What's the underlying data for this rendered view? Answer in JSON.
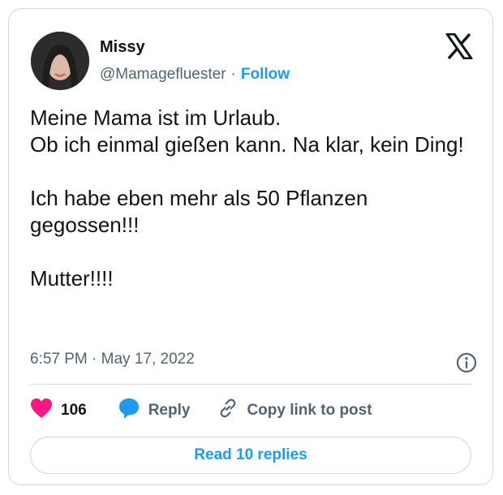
{
  "author": {
    "name": "Missy",
    "handle": "@Mamagefluester",
    "separator": "·",
    "follow_label": "Follow"
  },
  "tweet": {
    "lines": [
      "Meine Mama ist im Urlaub.",
      "Ob ich einmal gießen kann. Na klar, kein Ding!",
      "",
      "Ich habe eben mehr als 50 Pflanzen gegossen!!!",
      "",
      "Mutter!!!!"
    ],
    "timestamp": "6:57 PM · May 17, 2022"
  },
  "actions": {
    "like_count": "106",
    "reply_label": "Reply",
    "copy_label": "Copy link to post"
  },
  "read_replies_label": "Read 10 replies",
  "colors": {
    "accent": "#1d9bf0",
    "like": "#f91880",
    "text": "#0f1419",
    "muted": "#536471",
    "border": "#cfd9de"
  },
  "icons": [
    "x-logo-icon",
    "info-icon",
    "heart-icon",
    "reply-bubble-icon",
    "link-icon"
  ]
}
